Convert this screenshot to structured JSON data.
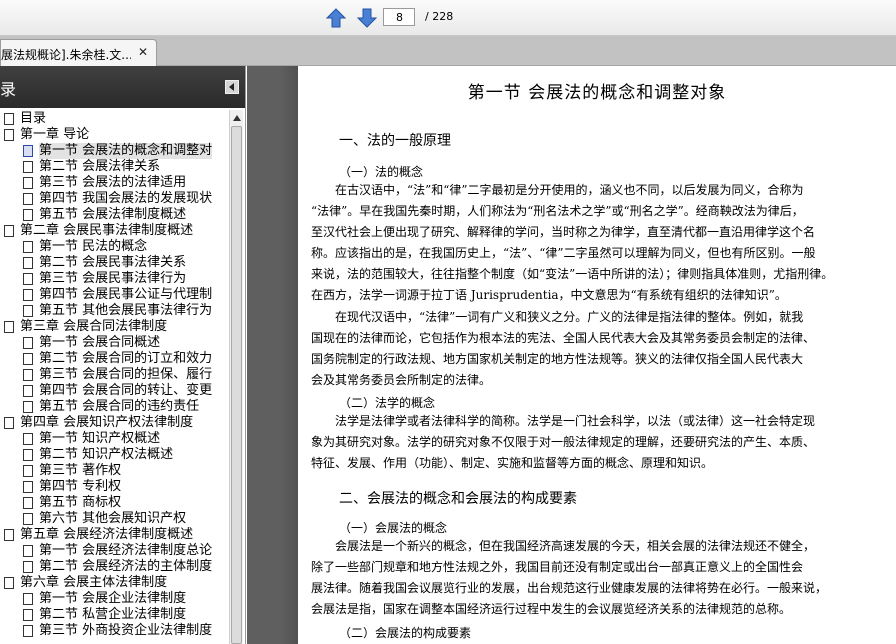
{
  "toolbar": {
    "page_number": "8",
    "page_total": "/ 228"
  },
  "tab": {
    "title": "展法规概论].朱余桂.文...",
    "close": "✕"
  },
  "sidebar": {
    "title": "录",
    "items": [
      {
        "label": "目录",
        "level": 0
      },
      {
        "label": "第一章   导论",
        "level": 0
      },
      {
        "label": "第一节   会展法的概念和调整对",
        "level": 1,
        "active": true
      },
      {
        "label": "第二节   会展法律关系",
        "level": 1
      },
      {
        "label": "第三节   会展法的法律适用",
        "level": 1
      },
      {
        "label": "第四节   我国会展法的发展现状",
        "level": 1
      },
      {
        "label": "第五节   会展法律制度概述",
        "level": 1
      },
      {
        "label": "第二章   会展民事法律制度概述",
        "level": 0
      },
      {
        "label": "第一节   民法的概念",
        "level": 1
      },
      {
        "label": "第二节   会展民事法律关系",
        "level": 1
      },
      {
        "label": "第三节   会展民事法律行为",
        "level": 1
      },
      {
        "label": "第四节   会展民事公证与代理制",
        "level": 1
      },
      {
        "label": "第五节   其他会展民事法律行为",
        "level": 1
      },
      {
        "label": "第三章   会展合同法律制度",
        "level": 0
      },
      {
        "label": "第一节   会展合同概述",
        "level": 1
      },
      {
        "label": "第二节   会展合同的订立和效力",
        "level": 1
      },
      {
        "label": "第三节   会展合同的担保、履行",
        "level": 1
      },
      {
        "label": "第四节   会展合同的转让、变更",
        "level": 1
      },
      {
        "label": "第五节   会展合同的违约责任",
        "level": 1
      },
      {
        "label": "第四章   会展知识产权法律制度",
        "level": 0
      },
      {
        "label": "第一节   知识产权概述",
        "level": 1
      },
      {
        "label": "第二节   知识产权法概述",
        "level": 1
      },
      {
        "label": "第三节   著作权",
        "level": 1
      },
      {
        "label": "第四节   专利权",
        "level": 1
      },
      {
        "label": "第五节   商标权",
        "level": 1
      },
      {
        "label": "第六节   其他会展知识产权",
        "level": 1
      },
      {
        "label": "第五章   会展经济法律制度概述",
        "level": 0
      },
      {
        "label": "第一节   会展经济法律制度总论",
        "level": 1
      },
      {
        "label": "第二节   会展经济法的主体制度",
        "level": 1
      },
      {
        "label": "第六章   会展主体法律制度",
        "level": 0
      },
      {
        "label": "第一节   会展企业法律制度",
        "level": 1
      },
      {
        "label": "第二节   私营企业法律制度",
        "level": 1
      },
      {
        "label": "第三节   外商投资企业法律制度",
        "level": 1
      }
    ]
  },
  "document": {
    "title": "第一节    会展法的概念和调整对象",
    "section1": "一、法的一般原理",
    "sub1": "（一）法的概念",
    "p1": [
      "在古汉语中，“法”和“律”二字最初是分开使用的，涵义也不同，以后发展为同义，合称为",
      "“法律”。早在我国先秦时期，人们称法为“刑名法术之学”或“刑名之学”。经商鞅改法为律后，",
      "至汉代社会上便出现了研究、解释律的学问，当时称之为律学，直至清代都一直沿用律学这个名",
      "称。应该指出的是，在我国历史上，“法”、“律”二字虽然可以理解为同义，但也有所区别。一般",
      "来说，法的范围较大，往往指整个制度（如“变法”一语中所讲的法）；律则指具体准则，尤指刑律。",
      "在西方，法学一词源于拉丁语 Jurisprudentia，中文意思为“有系统有组织的法律知识”。"
    ],
    "p2": [
      "在现代汉语中，“法律”一词有广义和狭义之分。广义的法律是指法律的整体。例如，就我",
      "国现在的法律而论，它包括作为根本法的宪法、全国人民代表大会及其常务委员会制定的法律、",
      "国务院制定的行政法规、地方国家机关制定的地方性法规等。狭义的法律仅指全国人民代表大",
      "会及其常务委员会所制定的法律。"
    ],
    "sub2": "（二）法学的概念",
    "p3": [
      "法学是法律学或者法律科学的简称。法学是一门社会科学，以法（或法律）这一社会特定现",
      "象为其研究对象。法学的研究对象不仅限于对一般法律规定的理解，还要研究法的产生、本质、",
      "特征、发展、作用（功能）、制定、实施和监督等方面的概念、原理和知识。"
    ],
    "section2": "二、会展法的概念和会展法的构成要素",
    "sub3": "（一）会展法的概念",
    "p4": [
      "会展法是一个新兴的概念，但在我国经济高速发展的今天，相关会展的法律法规还不健全，",
      "除了一些部门规章和地方性法规之外，我国目前还没有制定或出台一部真正意义上的全国性会",
      "展法律。随着我国会议展览行业的发展，出台规范这行业健康发展的法律将势在必行。一般来说，",
      "会展法是指，国家在调整本国经济运行过程中发生的会议展览经济关系的法律规范的总称。"
    ],
    "sub4": "（二）会展法的构成要素"
  }
}
